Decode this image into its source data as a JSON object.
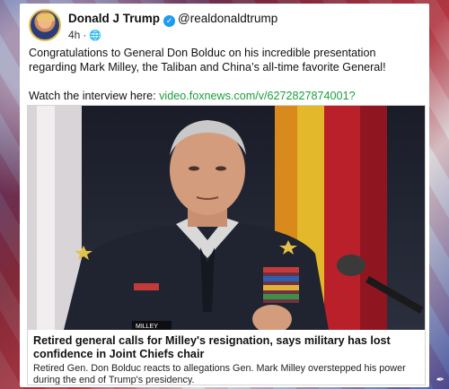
{
  "post": {
    "author_name": "Donald J Trump",
    "handle": "@realdonaldtrump",
    "time": "4h",
    "audience_icon": "globe-icon",
    "verified_icon": "verified-check-icon",
    "text_line1": "Congratulations to General Don Bolduc on his incredible presentation regarding Mark Milley, the Taliban and China’s all-time favorite General!",
    "text_line2_prefix": "Watch the interview here:",
    "link_text": "video.foxnews.com/v/6272827874001?utm_medium=…"
  },
  "card": {
    "name_tag": "MILLEY",
    "title": "Retired general calls for Milley's resignation, says military has lost confidence in Joint Chiefs chair",
    "description": "Retired Gen. Don Bolduc reacts to allegations Gen. Mark Milley overstepped his power during the end of Trump's presidency."
  },
  "colors": {
    "link": "#1c9e3c",
    "verified": "#1d9bf0"
  }
}
